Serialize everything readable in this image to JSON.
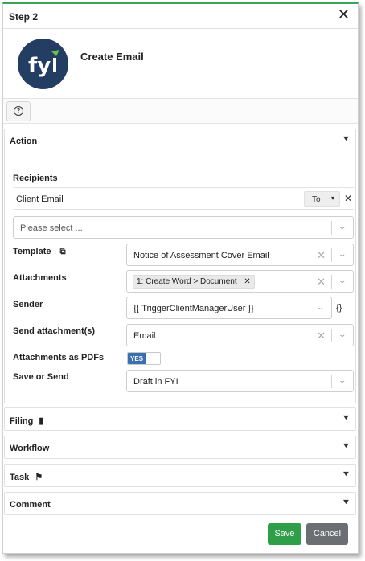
{
  "header": {
    "step_title": "Step 2",
    "close_icon": "close-icon"
  },
  "step": {
    "name": "Create Email",
    "logo_text": "fyi",
    "logo_color": "#233d63",
    "accent_color": "#6bc04b"
  },
  "help": {
    "icon": "help-icon",
    "glyph": "?"
  },
  "action": {
    "title": "Action",
    "recipients_label": "Recipients",
    "recipient": {
      "value": "Client Email",
      "type": "To"
    },
    "recipient_select": {
      "placeholder": "Please select ..."
    },
    "template": {
      "label": "Template",
      "value": "Notice of Assessment Cover Email"
    },
    "attachments": {
      "label": "Attachments",
      "tag": "1: Create Word > Document"
    },
    "sender": {
      "label": "Sender",
      "value": "{{ TriggerClientManagerUser }}",
      "braces": "{}"
    },
    "send_attachments": {
      "label": "Send attachment(s)",
      "value": "Email"
    },
    "attachments_as_pdfs": {
      "label": "Attachments as PDFs",
      "toggle": "YES"
    },
    "save_or_send": {
      "label": "Save or Send",
      "value": "Draft in FYI"
    }
  },
  "sections": {
    "filing": "Filing",
    "workflow": "Workflow",
    "task": "Task",
    "comment": "Comment"
  },
  "footer": {
    "save_label": "Save",
    "cancel_label": "Cancel",
    "save_color": "#2e9e48",
    "cancel_color": "#6b6e72"
  }
}
